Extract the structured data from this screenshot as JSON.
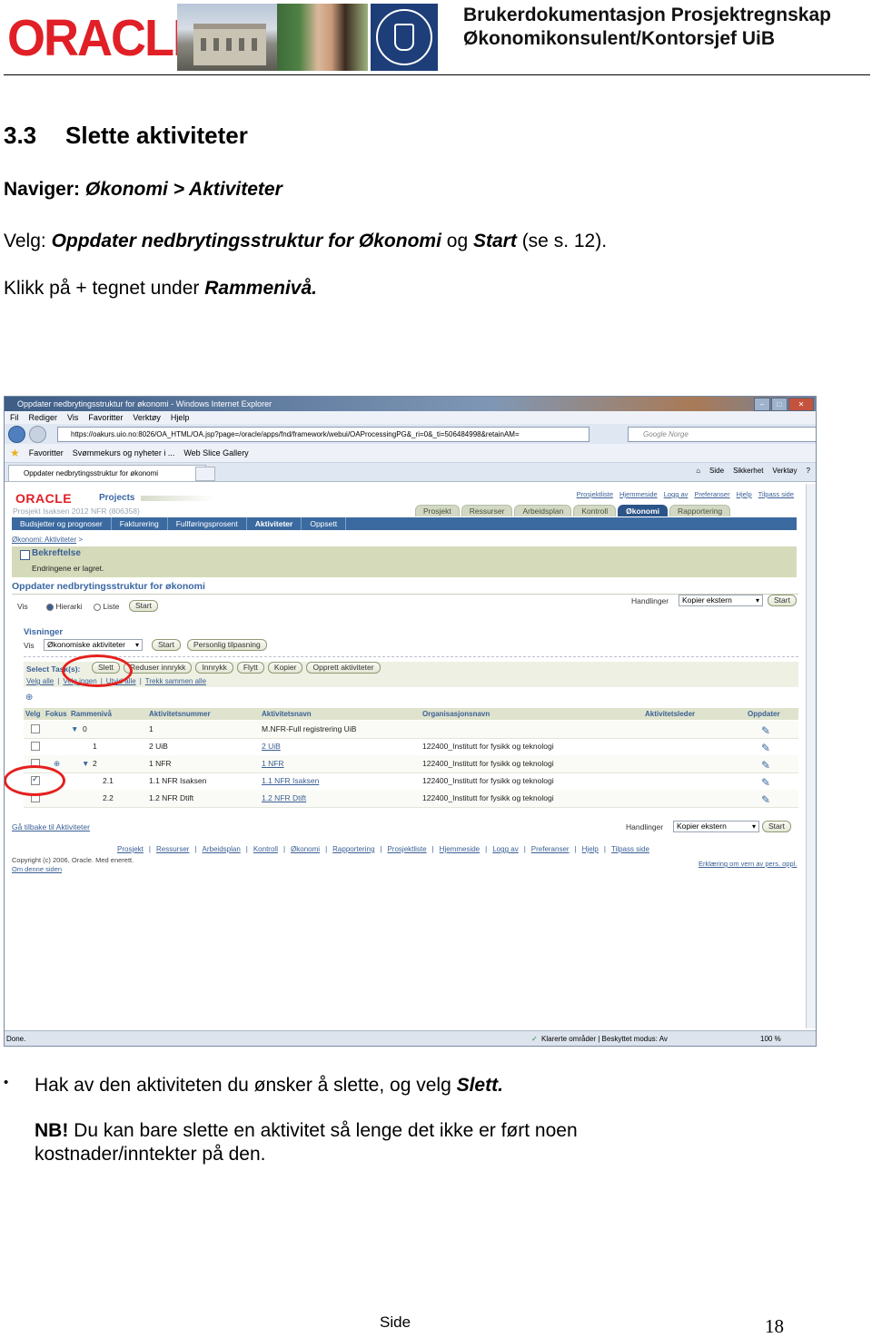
{
  "header": {
    "logo_text": "ORACLE",
    "title_line1": "Brukerdokumentasjon Prosjektregnskap",
    "title_line2": "Økonomikonsulent/Kontorsjef UiB"
  },
  "section": {
    "number": "3.3",
    "title": "Slette aktiviteter"
  },
  "navigate": {
    "label": "Naviger:",
    "path": "Økonomi > Aktiviteter"
  },
  "choose": {
    "label": "Velg:",
    "item": "Oppdater nedbrytingsstruktur for Økonomi",
    "and": "og",
    "start": "Start",
    "ref": "(se s. 12)."
  },
  "click": {
    "text": "Klikk på + tegnet under",
    "target": "Rammenivå."
  },
  "browser": {
    "title": "Oppdater nedbrytingsstruktur for økonomi - Windows Internet Explorer",
    "menu": [
      "Fil",
      "Rediger",
      "Vis",
      "Favoritter",
      "Verktøy",
      "Hjelp"
    ],
    "url": "https://oakurs.uio.no:8026/OA_HTML/OA.jsp?page=/oracle/apps/fnd/framework/webui/OAProcessingPG&_ri=0&_ti=506484998&retainAM=",
    "search_placeholder": "Google Norge",
    "favorites": [
      "Favoritter",
      "Svømmekurs og nyheter i ...",
      "Web Slice Gallery"
    ],
    "tab": "Oppdater nedbrytingsstruktur for økonomi",
    "commands": [
      "Side",
      "Sikkerhet",
      "Verktøy"
    ],
    "status_left": "Done.",
    "status_mid": "Klarerte områder | Beskyttet modus: Av",
    "zoom": "100 %"
  },
  "app": {
    "logo": "ORACLE",
    "product": "Projects",
    "project": "Prosjekt Isaksen 2012 NFR (806358)",
    "global_links": [
      "Prosjektliste",
      "Hjemmeside",
      "Logg av",
      "Preferanser",
      "Hjelp",
      "Tilpass side"
    ],
    "tabs": [
      "Prosjekt",
      "Ressurser",
      "Arbeidsplan",
      "Kontroll",
      "Økonomi",
      "Rapportering"
    ],
    "active_tab": "Økonomi",
    "subtabs": [
      "Budsjetter og prognoser",
      "Fakturering",
      "Fullføringsprosent",
      "Aktiviteter",
      "Oppsett"
    ],
    "breadcrumb": "Økonomi: Aktiviteter",
    "confirm_title": "Bekreftelse",
    "confirm_msg": "Endringene er lagret.",
    "page_title": "Oppdater nedbrytingsstruktur for økonomi",
    "vis_label": "Vis",
    "view_options": [
      "Hierarki",
      "Liste"
    ],
    "start": "Start",
    "actions_label": "Handlinger",
    "actions_value": "Kopier ekstern",
    "views_heading": "Visninger",
    "view_select": "Økonomiske aktiviteter",
    "personal_btn": "Personlig tilpasning",
    "select_label": "Select Task(s):",
    "task_buttons": [
      "Slett",
      "Reduser innrykk",
      "Innrykk",
      "Flytt",
      "Kopier",
      "Opprett aktiviteter"
    ],
    "select_all": "Velg alle",
    "select_none": "Velg ingen",
    "expand_all": "Utvid alle",
    "collapse_all": "Trekk sammen alle",
    "columns": [
      "Velg",
      "Fokus",
      "Rammenivå",
      "Aktivitetsnummer",
      "Aktivitetsnavn",
      "Organisasjonsnavn",
      "Aktivitetsleder",
      "Oppdater"
    ],
    "rows": [
      {
        "level": "0",
        "number": "1",
        "name": "M.NFR-Full registrering UiB",
        "org": "",
        "checked": false
      },
      {
        "level": "1",
        "number": "2 UiB",
        "name": "2 UiB",
        "org": "122400_Institutt for fysikk og teknologi",
        "checked": false
      },
      {
        "level": "2",
        "number": "1 NFR",
        "name": "1 NFR",
        "org": "122400_Institutt for fysikk og teknologi",
        "checked": false
      },
      {
        "level": "2.1",
        "number": "1.1 NFR Isaksen",
        "name": "1.1 NFR Isaksen",
        "org": "122400_Institutt for fysikk og teknologi",
        "checked": true
      },
      {
        "level": "2.2",
        "number": "1.2 NFR Dtift",
        "name": "1.2 NFR Dtift",
        "org": "122400_Institutt for fysikk og teknologi",
        "checked": false
      }
    ],
    "back_link": "Gå tilbake til Aktiviteter",
    "footer_links": [
      "Prosjekt",
      "Ressurser",
      "Arbeidsplan",
      "Kontroll",
      "Økonomi",
      "Rapportering",
      "Prosjektliste",
      "Hjemmeside",
      "Logg av",
      "Preferanser",
      "Hjelp",
      "Tilpass side"
    ],
    "copyright": "Copyright (c) 2006, Oracle. Med enerett.",
    "about": "Om denne siden",
    "privacy": "Erklæring om vern av pers. oppl."
  },
  "bullet": {
    "text": "Hak av den aktiviteten du ønsker å slette, og velg",
    "target": "Slett."
  },
  "note": {
    "label": "NB!",
    "line1": "Du kan bare slette en aktivitet så lenge det ikke er ført noen",
    "line2": "kostnader/inntekter på den."
  },
  "footer": {
    "label": "Side",
    "page": "18"
  },
  "colors": {
    "oracle_red": "#e01f26",
    "highlight": "#e5201e",
    "oracle_blue": "#3b6aa0"
  }
}
